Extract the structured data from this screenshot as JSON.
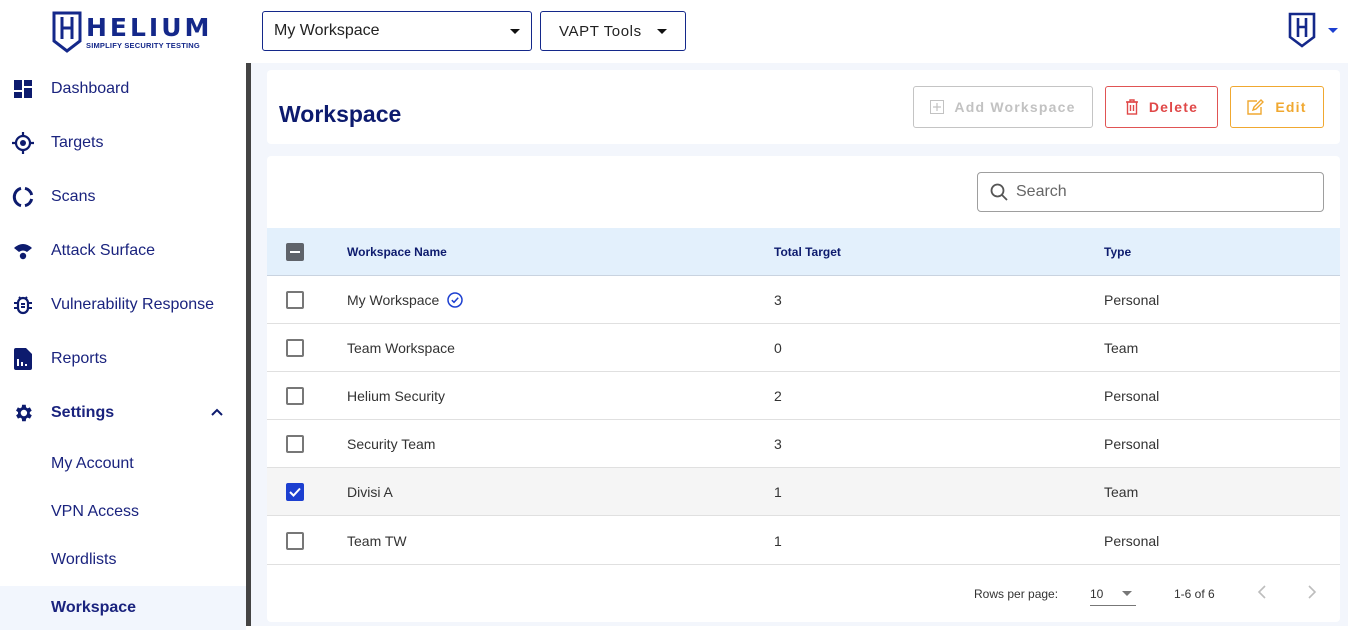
{
  "brand": {
    "name": "HELIUM",
    "tagline": "SIMPLIFY SECURITY TESTING"
  },
  "topbar": {
    "workspace_select": {
      "value": "My Workspace"
    },
    "tools_select": {
      "value": "VAPT Tools"
    },
    "user_menu": {
      "icon": "helium-shield-icon"
    }
  },
  "sidebar": {
    "items": [
      {
        "label": "Dashboard",
        "icon": "dashboard-icon"
      },
      {
        "label": "Targets",
        "icon": "target-icon"
      },
      {
        "label": "Scans",
        "icon": "scan-icon"
      },
      {
        "label": "Attack Surface",
        "icon": "attack-surface-icon"
      },
      {
        "label": "Vulnerability Response",
        "icon": "bug-icon"
      },
      {
        "label": "Reports",
        "icon": "report-icon"
      },
      {
        "label": "Settings",
        "icon": "gear-icon",
        "expanded": true
      }
    ],
    "settings_sub": [
      {
        "label": "My Account"
      },
      {
        "label": "VPN Access"
      },
      {
        "label": "Wordlists"
      },
      {
        "label": "Workspace",
        "active": true
      }
    ]
  },
  "header": {
    "title": "Workspace",
    "buttons": {
      "add": "Add Workspace",
      "delete": "Delete",
      "edit": "Edit"
    }
  },
  "table": {
    "search_placeholder": "Search",
    "columns": [
      "Workspace Name",
      "Total Target",
      "Type"
    ],
    "rows": [
      {
        "name": "My Workspace",
        "total": "3",
        "type": "Personal",
        "checked": false,
        "verified": true
      },
      {
        "name": "Team Workspace",
        "total": "0",
        "type": "Team",
        "checked": false
      },
      {
        "name": "Helium Security",
        "total": "2",
        "type": "Personal",
        "checked": false
      },
      {
        "name": "Security Team",
        "total": "3",
        "type": "Personal",
        "checked": false
      },
      {
        "name": "Divisi A",
        "total": "1",
        "type": "Team",
        "checked": true
      },
      {
        "name": "Team TW",
        "total": "1",
        "type": "Personal",
        "checked": false
      }
    ],
    "pagination": {
      "rows_per_page_label": "Rows per page:",
      "rows_per_page": "10",
      "range": "1-6 of 6"
    }
  },
  "colors": {
    "primary": "#14288a",
    "accent": "#1c3fd0",
    "delete": "#e04848",
    "edit": "#f0a830",
    "disabled": "#c2c2c2",
    "header_bg": "#e3f0fc"
  }
}
